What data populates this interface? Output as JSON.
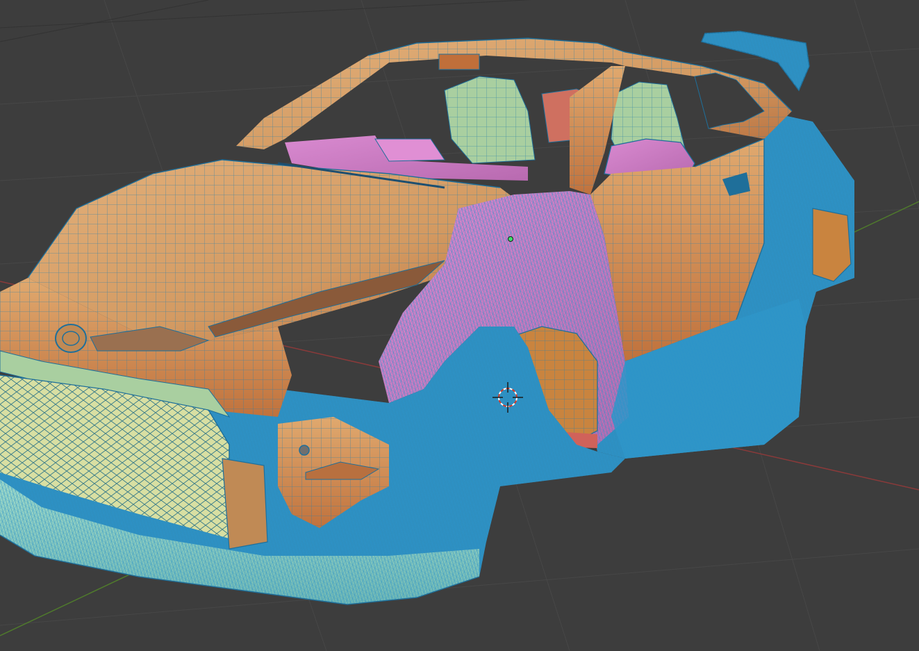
{
  "viewport": {
    "background_color": "#3d3d3d",
    "grid_color": "#333333",
    "axis_x_color": "#8a3a3a",
    "axis_y_color": "#4f7a2c",
    "wireframe_color": "#2c8fbf"
  },
  "model": {
    "body_color": "#d9a470",
    "body_shadow_color": "#b8703f",
    "trim_color": "#cf7fc4",
    "seat_color": "#a9cfa0",
    "grille_color": "#d8dfa2",
    "bumper_color": "#8fd0c4"
  },
  "cursor_icon": "3d-cursor-icon",
  "origin_icon": "object-origin-icon"
}
